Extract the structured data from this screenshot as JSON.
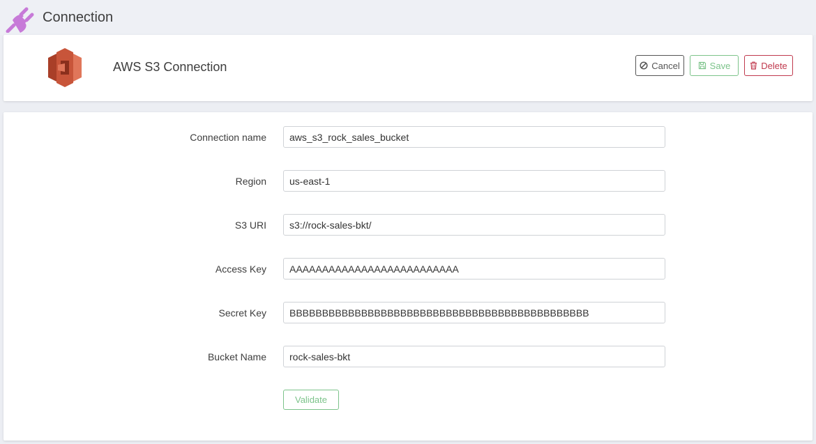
{
  "page": {
    "title": "Connection"
  },
  "header": {
    "connection_type": "AWS S3 Connection",
    "buttons": {
      "cancel": "Cancel",
      "save": "Save",
      "delete": "Delete"
    }
  },
  "form": {
    "fields": [
      {
        "label": "Connection name",
        "value": "aws_s3_rock_sales_bucket"
      },
      {
        "label": "Region",
        "value": "us-east-1"
      },
      {
        "label": "S3 URI",
        "value": "s3://rock-sales-bkt/"
      },
      {
        "label": "Access Key",
        "value": "AAAAAAAAAAAAAAAAAAAAAAAAAA"
      },
      {
        "label": "Secret Key",
        "value": "BBBBBBBBBBBBBBBBBBBBBBBBBBBBBBBBBBBBBBBBBBBBBB"
      },
      {
        "label": "Bucket Name",
        "value": "rock-sales-bkt"
      }
    ],
    "validate_label": "Validate"
  },
  "colors": {
    "plug_icon": "#c77ad8",
    "save": "#7cc38a",
    "delete": "#c0394d",
    "s3_logo": "#c8553a"
  },
  "icons": {
    "page": "plug-icon",
    "logo": "aws-s3-logo",
    "cancel": "ban-icon",
    "save": "floppy-disk-icon",
    "delete": "trash-icon"
  }
}
